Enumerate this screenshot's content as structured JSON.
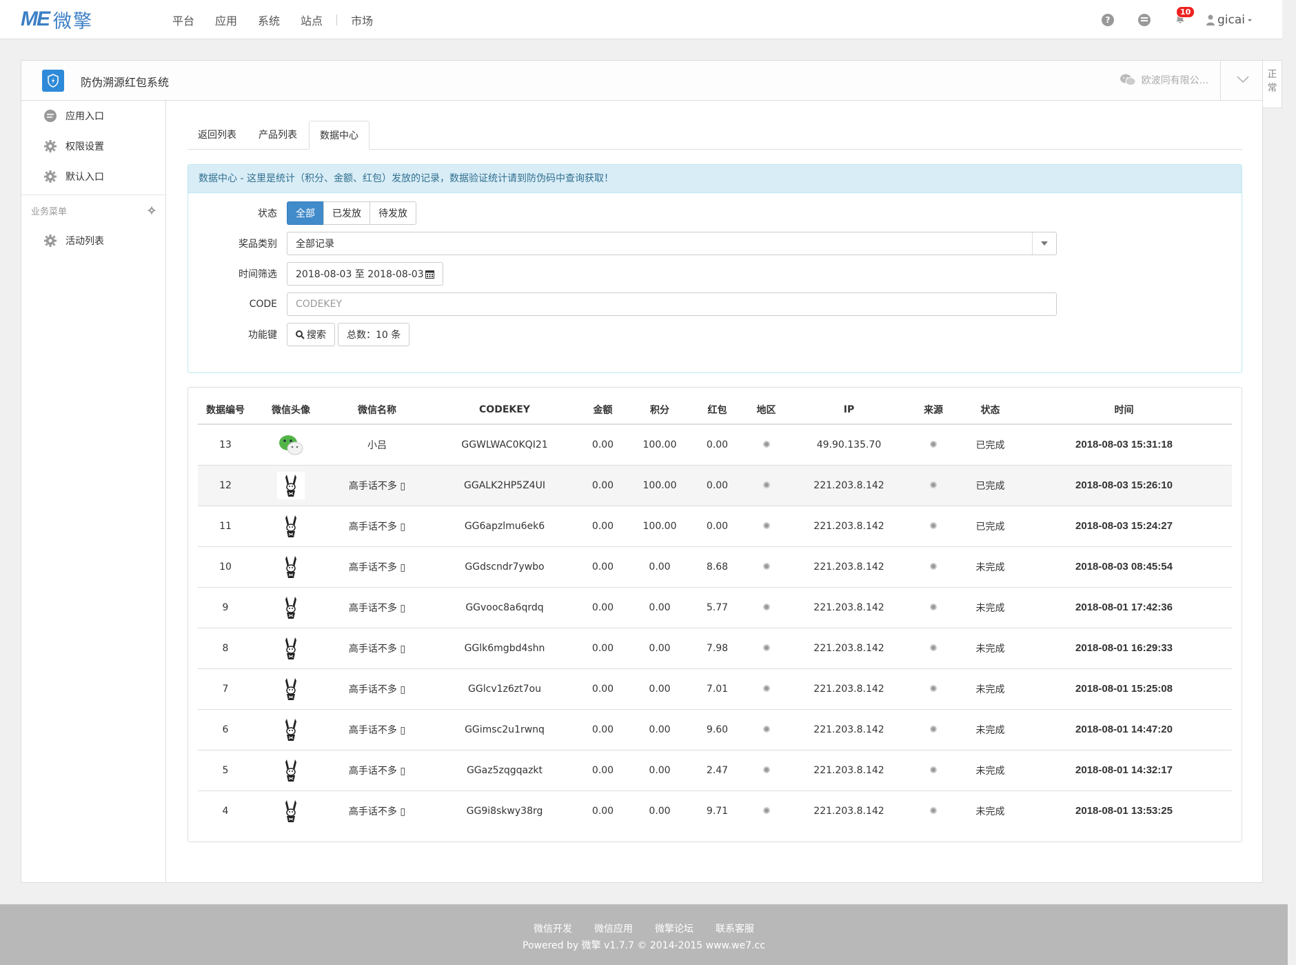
{
  "topbar": {
    "logo_me": "ME",
    "logo_cn": "微擎",
    "nav": [
      "平台",
      "应用",
      "系统",
      "站点",
      "市场"
    ],
    "help_glyph": "?",
    "notifications": "10",
    "username": "gicai"
  },
  "panel": {
    "app_title": "防伪溯源红包系统",
    "wechat_account": "欧波同有限公...",
    "side_tab": "正常"
  },
  "sidebar": {
    "items": [
      {
        "label": "应用入口",
        "icon": "chat-icon"
      },
      {
        "label": "权限设置",
        "icon": "gear-icon"
      },
      {
        "label": "默认入口",
        "icon": "gear-icon"
      }
    ],
    "section_title": "业务菜单",
    "section_items": [
      {
        "label": "活动列表",
        "icon": "gear-icon"
      }
    ]
  },
  "tabs": [
    "返回列表",
    "产品列表",
    "数据中心"
  ],
  "filter": {
    "notice": "数据中心 - 这里是统计（积分、金额、红包）发放的记录，数据验证统计请到防伪码中查询获取！",
    "status_label": "状态",
    "status_options": [
      "全部",
      "已发放",
      "待发放"
    ],
    "category_label": "奖品类别",
    "category_value": "全部记录",
    "time_label": "时间筛选",
    "time_value": "2018-08-03 至 2018-08-03",
    "code_label": "CODE",
    "code_placeholder": "CODEKEY",
    "func_label": "功能键",
    "search_label": "搜索",
    "total_label": "总数：10 条"
  },
  "table": {
    "headers": [
      "数据编号",
      "微信头像",
      "微信名称",
      "CODEKEY",
      "金额",
      "积分",
      "红包",
      "地区",
      "IP",
      "来源",
      "状态",
      "时间"
    ],
    "rows": [
      {
        "id": "13",
        "avatar": "wechat",
        "name": "小吕",
        "code": "GGWLWAC0KQI21",
        "amount": "0.00",
        "points": "100.00",
        "red": "0.00",
        "ip": "49.90.135.70",
        "status": "已完成",
        "time": "2018-08-03 15:31:18"
      },
      {
        "id": "12",
        "avatar": "rabbit",
        "name": "高手话不多 ▯",
        "code": "GGALK2HP5Z4UI",
        "amount": "0.00",
        "points": "100.00",
        "red": "0.00",
        "ip": "221.203.8.142",
        "status": "已完成",
        "time": "2018-08-03 15:26:10"
      },
      {
        "id": "11",
        "avatar": "rabbit",
        "name": "高手话不多 ▯",
        "code": "GG6apzlmu6ek6",
        "amount": "0.00",
        "points": "100.00",
        "red": "0.00",
        "ip": "221.203.8.142",
        "status": "已完成",
        "time": "2018-08-03 15:24:27"
      },
      {
        "id": "10",
        "avatar": "rabbit",
        "name": "高手话不多 ▯",
        "code": "GGdscndr7ywbo",
        "amount": "0.00",
        "points": "0.00",
        "red": "8.68",
        "ip": "221.203.8.142",
        "status": "未完成",
        "time": "2018-08-03 08:45:54"
      },
      {
        "id": "9",
        "avatar": "rabbit",
        "name": "高手话不多 ▯",
        "code": "GGvooc8a6qrdq",
        "amount": "0.00",
        "points": "0.00",
        "red": "5.77",
        "ip": "221.203.8.142",
        "status": "未完成",
        "time": "2018-08-01 17:42:36"
      },
      {
        "id": "8",
        "avatar": "rabbit",
        "name": "高手话不多 ▯",
        "code": "GGlk6mgbd4shn",
        "amount": "0.00",
        "points": "0.00",
        "red": "7.98",
        "ip": "221.203.8.142",
        "status": "未完成",
        "time": "2018-08-01 16:29:33"
      },
      {
        "id": "7",
        "avatar": "rabbit",
        "name": "高手话不多 ▯",
        "code": "GGlcv1z6zt7ou",
        "amount": "0.00",
        "points": "0.00",
        "red": "7.01",
        "ip": "221.203.8.142",
        "status": "未完成",
        "time": "2018-08-01 15:25:08"
      },
      {
        "id": "6",
        "avatar": "rabbit",
        "name": "高手话不多 ▯",
        "code": "GGimsc2u1rwnq",
        "amount": "0.00",
        "points": "0.00",
        "red": "9.60",
        "ip": "221.203.8.142",
        "status": "未完成",
        "time": "2018-08-01 14:47:20"
      },
      {
        "id": "5",
        "avatar": "rabbit",
        "name": "高手话不多 ▯",
        "code": "GGaz5zqgqazkt",
        "amount": "0.00",
        "points": "0.00",
        "red": "2.47",
        "ip": "221.203.8.142",
        "status": "未完成",
        "time": "2018-08-01 14:32:17"
      },
      {
        "id": "4",
        "avatar": "rabbit",
        "name": "高手话不多 ▯",
        "code": "GG9i8skwy38rg",
        "amount": "0.00",
        "points": "0.00",
        "red": "9.71",
        "ip": "221.203.8.142",
        "status": "未完成",
        "time": "2018-08-01 13:53:25"
      }
    ]
  },
  "footer": {
    "links": [
      "微信开发",
      "微信应用",
      "微擎论坛",
      "联系客服"
    ],
    "copyright": "Powered by 微擎 v1.7.7 © 2014-2015 www.we7.cc"
  },
  "colors": {
    "primary": "#428bca",
    "logo": "#3c80c6",
    "notice_bg": "#d9edf7",
    "notice_text": "#31708f",
    "badge": "#e22222",
    "footer_bg": "#b8b8b8"
  }
}
